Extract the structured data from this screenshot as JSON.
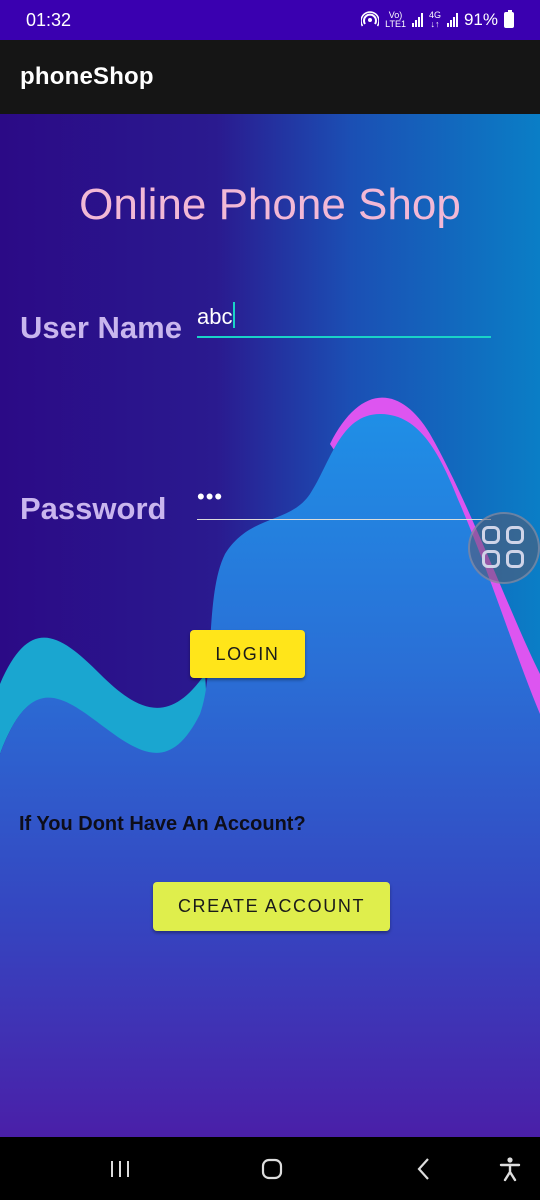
{
  "status_bar": {
    "time": "01:32",
    "net_top": "Vo)",
    "net_bottom": "LTE1",
    "net2_top": "4G",
    "net2_bottom": "↓↑",
    "battery": "91%"
  },
  "app_bar": {
    "title": "phoneShop"
  },
  "main": {
    "headline": "Online Phone Shop",
    "username_label": "User Name",
    "username_value": "abc",
    "password_label": "Password",
    "password_value": "•••",
    "login_label": "LOGIN",
    "hint_text": "If You Dont Have An Account?",
    "create_account_label": "CREATE ACCOUNT"
  },
  "colors": {
    "accent": "#19d3c7",
    "login_button": "#ffe51a",
    "create_button": "#dfee4c",
    "headline": "#f2b8d6"
  },
  "icons": {
    "floating": "grid-apps-icon",
    "nav": [
      "recents-icon",
      "home-icon",
      "back-icon",
      "accessibility-icon"
    ]
  }
}
